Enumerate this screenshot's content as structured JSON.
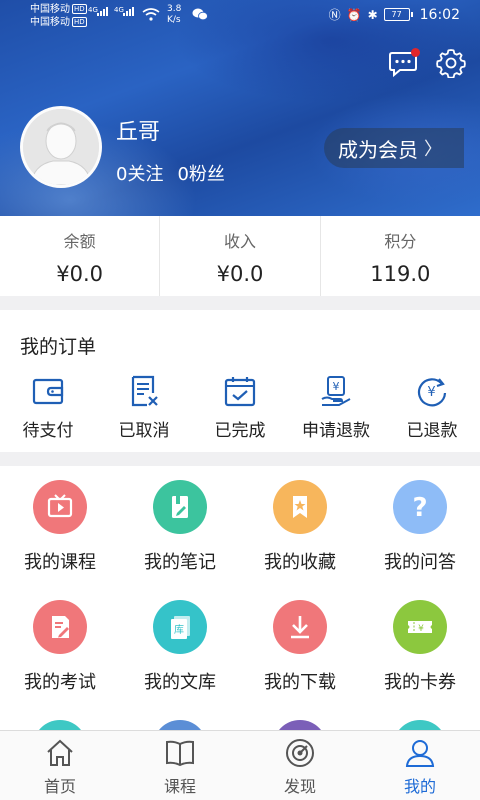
{
  "status_bar": {
    "carrier_1": "中国移动",
    "carrier_2": "中国移动",
    "hd_badge": "HD",
    "net_type": "4G",
    "speed_value": "3.8",
    "speed_unit": "K/s",
    "battery": "77",
    "time": "16:02"
  },
  "header": {
    "username": "丘哥",
    "following": "0关注",
    "followers": "0粉丝",
    "vip_button": "成为会员",
    "icons": [
      "message-icon",
      "gear-icon"
    ],
    "accent_color": "#2a63c3",
    "notification_dot_color": "#e0262b"
  },
  "stats": [
    {
      "label": "余额",
      "value": "¥0.0"
    },
    {
      "label": "收入",
      "value": "¥0.0"
    },
    {
      "label": "积分",
      "value": "119.0"
    }
  ],
  "orders": {
    "title": "我的订单",
    "items": [
      {
        "label": "待支付",
        "icon": "wallet-icon"
      },
      {
        "label": "已取消",
        "icon": "cancelled-doc-icon"
      },
      {
        "label": "已完成",
        "icon": "completed-check-icon"
      },
      {
        "label": "申请退款",
        "icon": "refund-request-icon"
      },
      {
        "label": "已退款",
        "icon": "refunded-icon"
      }
    ]
  },
  "grid": [
    {
      "label": "我的课程",
      "icon": "course-play-icon",
      "color": "#f0777a"
    },
    {
      "label": "我的笔记",
      "icon": "notes-icon",
      "color": "#3cc49e"
    },
    {
      "label": "我的收藏",
      "icon": "favorite-star-icon",
      "color": "#f7b65c"
    },
    {
      "label": "我的问答",
      "icon": "question-icon",
      "color": "#8ebcf7"
    },
    {
      "label": "我的考试",
      "icon": "exam-icon",
      "color": "#f0777a"
    },
    {
      "label": "我的文库",
      "icon": "library-icon",
      "color": "#35c3c9"
    },
    {
      "label": "我的下载",
      "icon": "download-icon",
      "color": "#f0777a"
    },
    {
      "label": "我的卡券",
      "icon": "coupon-icon",
      "color": "#8cc83e"
    },
    {
      "label": "",
      "icon": "more-icon",
      "color": "#3ec8c4"
    },
    {
      "label": "",
      "icon": "more-icon",
      "color": "#5b8ed6"
    },
    {
      "label": "",
      "icon": "more-icon",
      "color": "#7b5fb8"
    },
    {
      "label": "",
      "icon": "more-icon",
      "color": "#3ec8c4"
    }
  ],
  "tabs": [
    {
      "label": "首页",
      "icon": "home-icon",
      "active": false
    },
    {
      "label": "课程",
      "icon": "book-icon",
      "active": false
    },
    {
      "label": "发现",
      "icon": "discover-icon",
      "active": false
    },
    {
      "label": "我的",
      "icon": "profile-icon",
      "active": true
    }
  ],
  "colors": {
    "active_tab": "#1e6bd6",
    "order_icon": "#1f5fb5"
  }
}
